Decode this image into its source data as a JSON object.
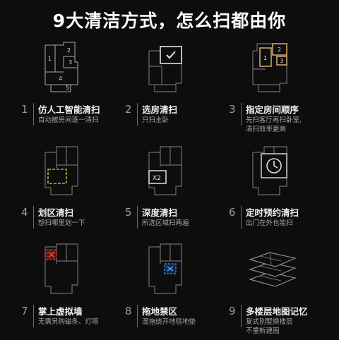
{
  "title": "9大清洁方式，怎么扫都由你",
  "features": [
    {
      "num": "1",
      "title": "仿人工智能清扫",
      "desc": [
        "自动按房间逐一清扫"
      ],
      "room_labels": [
        "1",
        "2",
        "3",
        "4",
        "5"
      ]
    },
    {
      "num": "2",
      "title": "选房清扫",
      "desc": [
        "只扫主卧"
      ]
    },
    {
      "num": "3",
      "title": "指定房间顺序",
      "desc": [
        "先扫客厅再扫卧室,",
        "清扫效率更高"
      ],
      "room_labels": [
        "1",
        "2",
        "3"
      ]
    },
    {
      "num": "4",
      "title": "划区清扫",
      "desc": [
        "想扫哪里划一下"
      ]
    },
    {
      "num": "5",
      "title": "深度清扫",
      "desc": [
        "所选区域扫两遍"
      ],
      "badge": "X2"
    },
    {
      "num": "6",
      "title": "定时预约清扫",
      "desc": [
        "出门在外也能扫"
      ]
    },
    {
      "num": "7",
      "title": "掌上虚拟墙",
      "desc": [
        "无需另购磁条、灯塔"
      ]
    },
    {
      "num": "8",
      "title": "拖地禁区",
      "desc": [
        "湿拖绕开地毯地垫"
      ]
    },
    {
      "num": "9",
      "title": "多楼层地图记忆",
      "desc": [
        "复式别墅换楼层",
        "不重新建图"
      ]
    }
  ],
  "colors": {
    "background": "#0d0d0d",
    "floorplan_line": "#8a8a8a",
    "accent_gold": "#c9a46a",
    "no_go_red": "#c0392b",
    "no_mop_blue": "#3a7bd5"
  }
}
